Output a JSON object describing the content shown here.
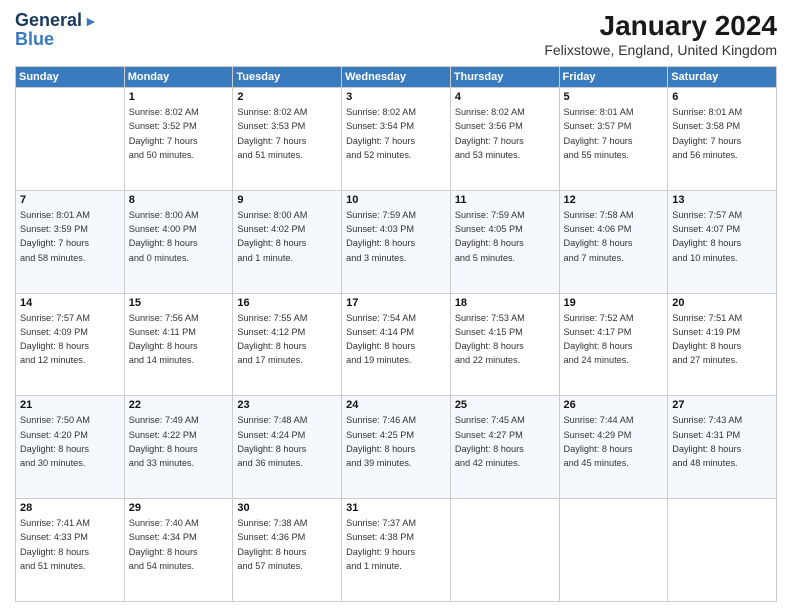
{
  "header": {
    "logo_line1": "General",
    "logo_line2": "Blue",
    "title": "January 2024",
    "subtitle": "Felixstowe, England, United Kingdom"
  },
  "days_of_week": [
    "Sunday",
    "Monday",
    "Tuesday",
    "Wednesday",
    "Thursday",
    "Friday",
    "Saturday"
  ],
  "weeks": [
    [
      {
        "day": "",
        "info": ""
      },
      {
        "day": "1",
        "info": "Sunrise: 8:02 AM\nSunset: 3:52 PM\nDaylight: 7 hours\nand 50 minutes."
      },
      {
        "day": "2",
        "info": "Sunrise: 8:02 AM\nSunset: 3:53 PM\nDaylight: 7 hours\nand 51 minutes."
      },
      {
        "day": "3",
        "info": "Sunrise: 8:02 AM\nSunset: 3:54 PM\nDaylight: 7 hours\nand 52 minutes."
      },
      {
        "day": "4",
        "info": "Sunrise: 8:02 AM\nSunset: 3:56 PM\nDaylight: 7 hours\nand 53 minutes."
      },
      {
        "day": "5",
        "info": "Sunrise: 8:01 AM\nSunset: 3:57 PM\nDaylight: 7 hours\nand 55 minutes."
      },
      {
        "day": "6",
        "info": "Sunrise: 8:01 AM\nSunset: 3:58 PM\nDaylight: 7 hours\nand 56 minutes."
      }
    ],
    [
      {
        "day": "7",
        "info": "Sunrise: 8:01 AM\nSunset: 3:59 PM\nDaylight: 7 hours\nand 58 minutes."
      },
      {
        "day": "8",
        "info": "Sunrise: 8:00 AM\nSunset: 4:00 PM\nDaylight: 8 hours\nand 0 minutes."
      },
      {
        "day": "9",
        "info": "Sunrise: 8:00 AM\nSunset: 4:02 PM\nDaylight: 8 hours\nand 1 minute."
      },
      {
        "day": "10",
        "info": "Sunrise: 7:59 AM\nSunset: 4:03 PM\nDaylight: 8 hours\nand 3 minutes."
      },
      {
        "day": "11",
        "info": "Sunrise: 7:59 AM\nSunset: 4:05 PM\nDaylight: 8 hours\nand 5 minutes."
      },
      {
        "day": "12",
        "info": "Sunrise: 7:58 AM\nSunset: 4:06 PM\nDaylight: 8 hours\nand 7 minutes."
      },
      {
        "day": "13",
        "info": "Sunrise: 7:57 AM\nSunset: 4:07 PM\nDaylight: 8 hours\nand 10 minutes."
      }
    ],
    [
      {
        "day": "14",
        "info": "Sunrise: 7:57 AM\nSunset: 4:09 PM\nDaylight: 8 hours\nand 12 minutes."
      },
      {
        "day": "15",
        "info": "Sunrise: 7:56 AM\nSunset: 4:11 PM\nDaylight: 8 hours\nand 14 minutes."
      },
      {
        "day": "16",
        "info": "Sunrise: 7:55 AM\nSunset: 4:12 PM\nDaylight: 8 hours\nand 17 minutes."
      },
      {
        "day": "17",
        "info": "Sunrise: 7:54 AM\nSunset: 4:14 PM\nDaylight: 8 hours\nand 19 minutes."
      },
      {
        "day": "18",
        "info": "Sunrise: 7:53 AM\nSunset: 4:15 PM\nDaylight: 8 hours\nand 22 minutes."
      },
      {
        "day": "19",
        "info": "Sunrise: 7:52 AM\nSunset: 4:17 PM\nDaylight: 8 hours\nand 24 minutes."
      },
      {
        "day": "20",
        "info": "Sunrise: 7:51 AM\nSunset: 4:19 PM\nDaylight: 8 hours\nand 27 minutes."
      }
    ],
    [
      {
        "day": "21",
        "info": "Sunrise: 7:50 AM\nSunset: 4:20 PM\nDaylight: 8 hours\nand 30 minutes."
      },
      {
        "day": "22",
        "info": "Sunrise: 7:49 AM\nSunset: 4:22 PM\nDaylight: 8 hours\nand 33 minutes."
      },
      {
        "day": "23",
        "info": "Sunrise: 7:48 AM\nSunset: 4:24 PM\nDaylight: 8 hours\nand 36 minutes."
      },
      {
        "day": "24",
        "info": "Sunrise: 7:46 AM\nSunset: 4:25 PM\nDaylight: 8 hours\nand 39 minutes."
      },
      {
        "day": "25",
        "info": "Sunrise: 7:45 AM\nSunset: 4:27 PM\nDaylight: 8 hours\nand 42 minutes."
      },
      {
        "day": "26",
        "info": "Sunrise: 7:44 AM\nSunset: 4:29 PM\nDaylight: 8 hours\nand 45 minutes."
      },
      {
        "day": "27",
        "info": "Sunrise: 7:43 AM\nSunset: 4:31 PM\nDaylight: 8 hours\nand 48 minutes."
      }
    ],
    [
      {
        "day": "28",
        "info": "Sunrise: 7:41 AM\nSunset: 4:33 PM\nDaylight: 8 hours\nand 51 minutes."
      },
      {
        "day": "29",
        "info": "Sunrise: 7:40 AM\nSunset: 4:34 PM\nDaylight: 8 hours\nand 54 minutes."
      },
      {
        "day": "30",
        "info": "Sunrise: 7:38 AM\nSunset: 4:36 PM\nDaylight: 8 hours\nand 57 minutes."
      },
      {
        "day": "31",
        "info": "Sunrise: 7:37 AM\nSunset: 4:38 PM\nDaylight: 9 hours\nand 1 minute."
      },
      {
        "day": "",
        "info": ""
      },
      {
        "day": "",
        "info": ""
      },
      {
        "day": "",
        "info": ""
      }
    ]
  ]
}
